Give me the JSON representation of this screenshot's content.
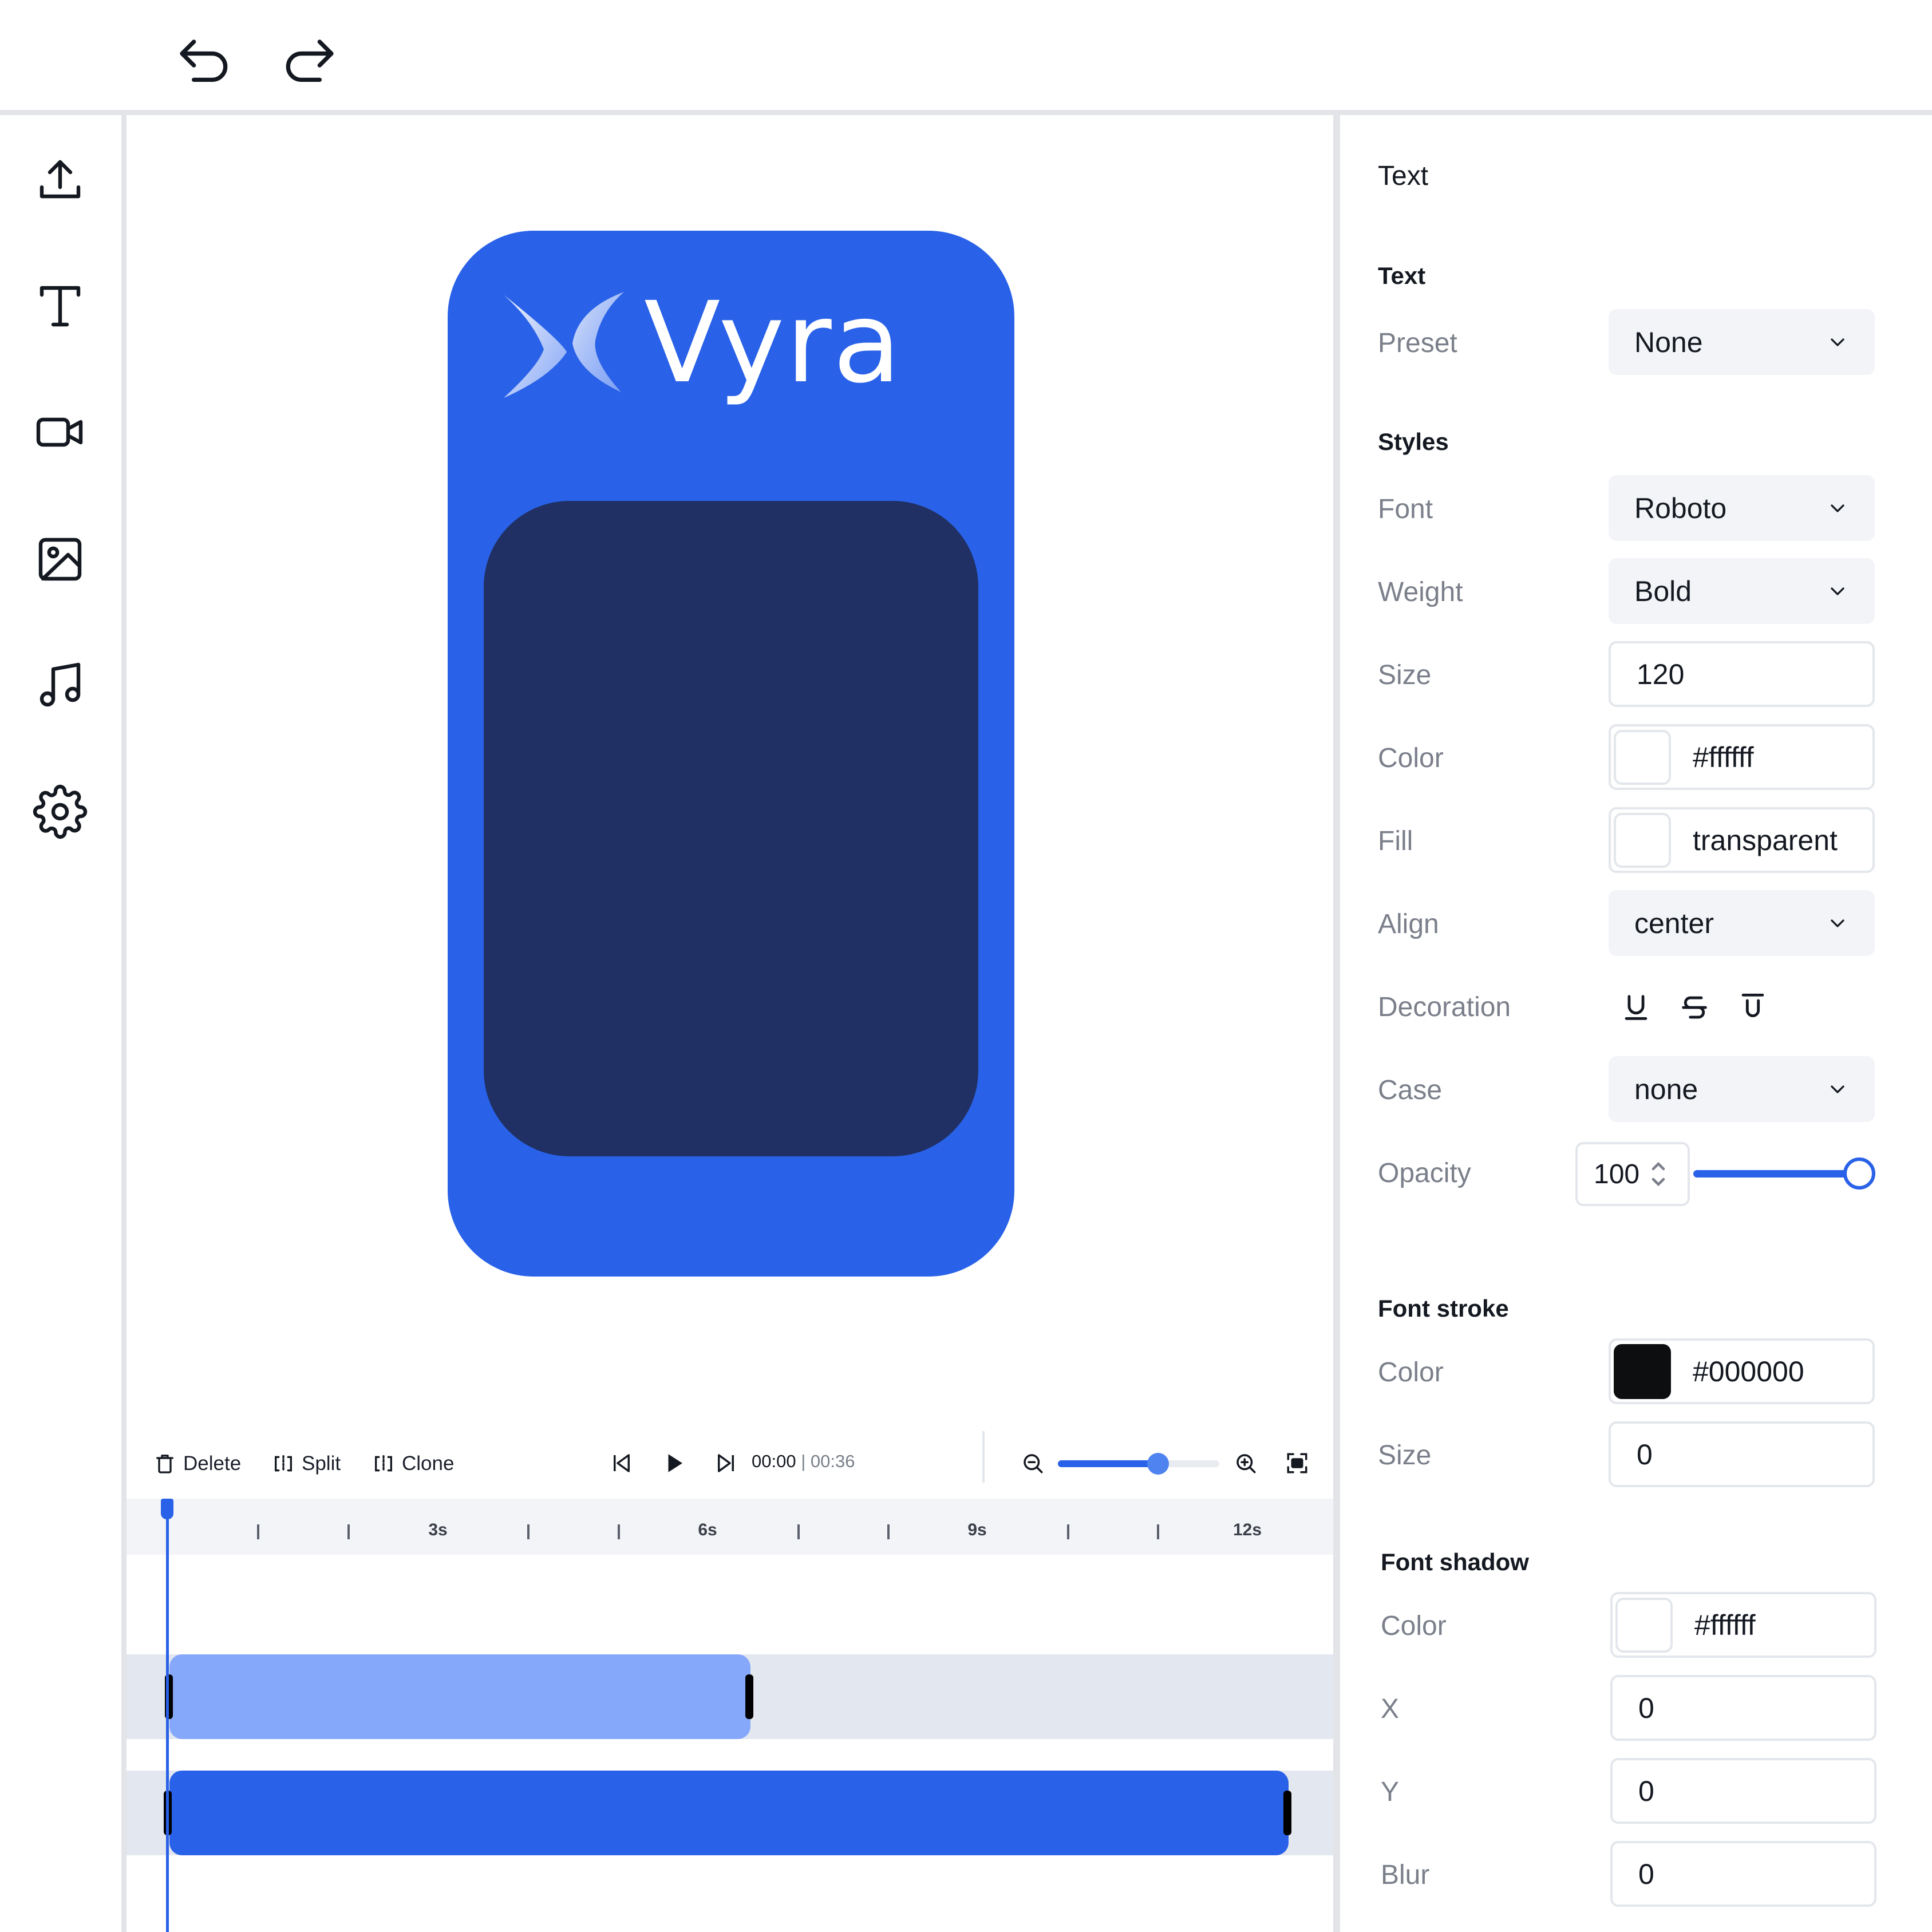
{
  "toolbar": {
    "undo_icon": "undo-icon",
    "redo_icon": "redo-icon"
  },
  "rail": {
    "items": [
      {
        "name": "upload",
        "icon": "upload-icon"
      },
      {
        "name": "text",
        "icon": "text-icon"
      },
      {
        "name": "video",
        "icon": "video-icon"
      },
      {
        "name": "image",
        "icon": "image-icon"
      },
      {
        "name": "audio",
        "icon": "music-icon"
      },
      {
        "name": "settings",
        "icon": "gear-icon"
      }
    ]
  },
  "canvas": {
    "logo_text": "Vyra",
    "background_color": "#2962e8",
    "slot_color": "#203064"
  },
  "timeline": {
    "delete_label": "Delete",
    "split_label": "Split",
    "clone_label": "Clone",
    "current_time": "00:00",
    "separator": "|",
    "total_time": "00:36",
    "zoom": 0.62,
    "ticks": [
      "3s",
      "6s",
      "9s",
      "12s"
    ],
    "clip_colors": {
      "text_clip": "#86a8fb",
      "video_clip": "#2962e8"
    }
  },
  "panel": {
    "header": "Text",
    "text_section": "Text",
    "preset_label": "Preset",
    "preset_value": "None",
    "styles_section": "Styles",
    "font_label": "Font",
    "font_value": "Roboto",
    "weight_label": "Weight",
    "weight_value": "Bold",
    "size_label": "Size",
    "size_value": "120",
    "color_label": "Color",
    "color_value": "#ffffff",
    "fill_label": "Fill",
    "fill_value": "transparent",
    "align_label": "Align",
    "align_value": "center",
    "decoration_label": "Decoration",
    "case_label": "Case",
    "case_value": "none",
    "opacity_label": "Opacity",
    "opacity_value": "100",
    "opacity_percent": 100,
    "stroke_section": "Font stroke",
    "stroke_color_label": "Color",
    "stroke_color_value": "#000000",
    "stroke_size_label": "Size",
    "stroke_size_value": "0",
    "shadow_section": "Font shadow",
    "shadow_color_label": "Color",
    "shadow_color_value": "#ffffff",
    "shadow_x_label": "X",
    "shadow_x_value": "0",
    "shadow_y_label": "Y",
    "shadow_y_value": "0",
    "shadow_blur_label": "Blur",
    "shadow_blur_value": "0",
    "accent_color": "#2962e8"
  }
}
